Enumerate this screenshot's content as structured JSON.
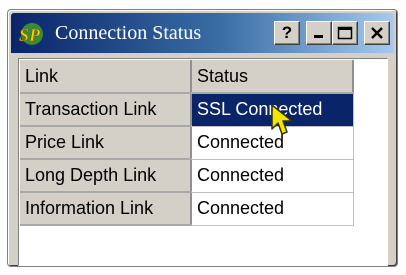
{
  "window": {
    "title": "Connection Status",
    "icon": "sp-app-icon",
    "buttons": {
      "help": "?"
    }
  },
  "table": {
    "headers": [
      "Link",
      "Status"
    ],
    "rows": [
      {
        "link": "Transaction Link",
        "status": "SSL Connected",
        "selected": true
      },
      {
        "link": "Price Link",
        "status": "Connected"
      },
      {
        "link": "Long Depth Link",
        "status": "Connected"
      },
      {
        "link": "Information Link",
        "status": "Connected"
      }
    ]
  },
  "colors": {
    "titlebar_start": "#0a246a",
    "titlebar_end": "#a6caf0",
    "selection": "#0a246a",
    "cursor": "#f2e600"
  }
}
